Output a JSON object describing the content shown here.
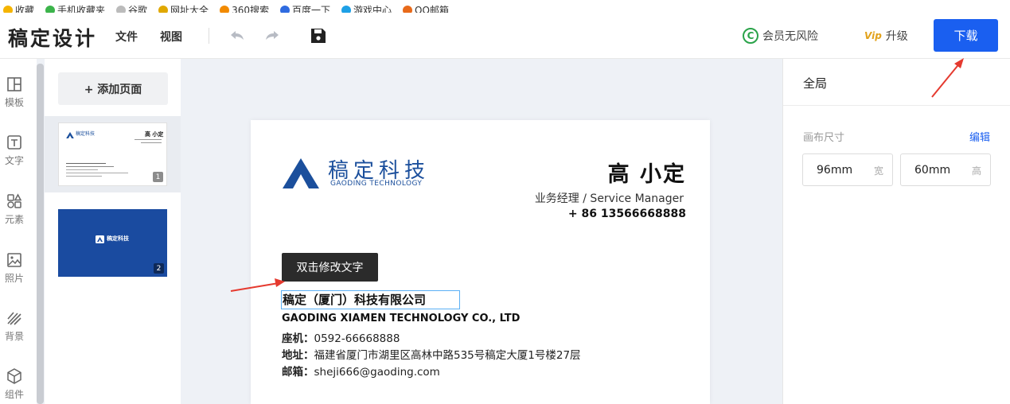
{
  "bookmarks": [
    {
      "label": "收藏",
      "color": "#f5b400"
    },
    {
      "label": "手机收藏夹",
      "color": "#3cb44b"
    },
    {
      "label": "谷歌",
      "color": "#bbbbbb"
    },
    {
      "label": "网址大全",
      "color": "#e0a800"
    },
    {
      "label": "360搜索",
      "color": "#f28a00"
    },
    {
      "label": "百度一下",
      "color": "#2f6be0"
    },
    {
      "label": "游戏中心",
      "color": "#1ea0e6"
    },
    {
      "label": "QQ邮箱",
      "color": "#e86a1a"
    }
  ],
  "toolbar": {
    "app_title": "稿定设计",
    "menu_file": "文件",
    "menu_view": "视图",
    "member_label": "会员无风险",
    "member_icon_text": "C",
    "upgrade_label": "升级",
    "upgrade_icon_text": "Vip",
    "download_label": "下载"
  },
  "sidebar": {
    "items": [
      {
        "label": "模板",
        "icon": "layout-icon"
      },
      {
        "label": "文字",
        "icon": "text-icon"
      },
      {
        "label": "元素",
        "icon": "elements-icon"
      },
      {
        "label": "照片",
        "icon": "photo-icon"
      },
      {
        "label": "背景",
        "icon": "background-icon"
      },
      {
        "label": "组件",
        "icon": "component-icon"
      }
    ]
  },
  "pages": {
    "add_label": "+ 添加页面",
    "page1_num": "1",
    "page2_num": "2",
    "thumb1_brand": "稿定科技",
    "thumb1_name": "高 小定",
    "thumb2_brand": "稿定科技"
  },
  "card": {
    "brand_cn": "稿定科技",
    "brand_en": "GAODING TECHNOLOGY",
    "person_name": "高 小定",
    "job_title": "业务经理 / Service Manager",
    "phone": "+ 86 13566668888",
    "tooltip": "双击修改文字",
    "company_cn": "稿定（厦门）科技有限公司",
    "company_en": "GAODING XIAMEN TECHNOLOGY CO., LTD",
    "landline_label": "座机：",
    "landline_value": "0592-66668888",
    "address_label": "地址：",
    "address_value": "福建省厦门市湖里区高林中路535号稿定大厦1号楼27层",
    "email_label": "邮箱：",
    "email_value": "sheji666@gaoding.com",
    "brand_color": "#1b4f9c"
  },
  "panel": {
    "title": "全局",
    "canvas_size_label": "画布尺寸",
    "edit_label": "编辑",
    "width_value": "96mm",
    "width_unit": "宽",
    "height_value": "60mm",
    "height_unit": "高"
  },
  "accent_color": "#1a5ff0"
}
